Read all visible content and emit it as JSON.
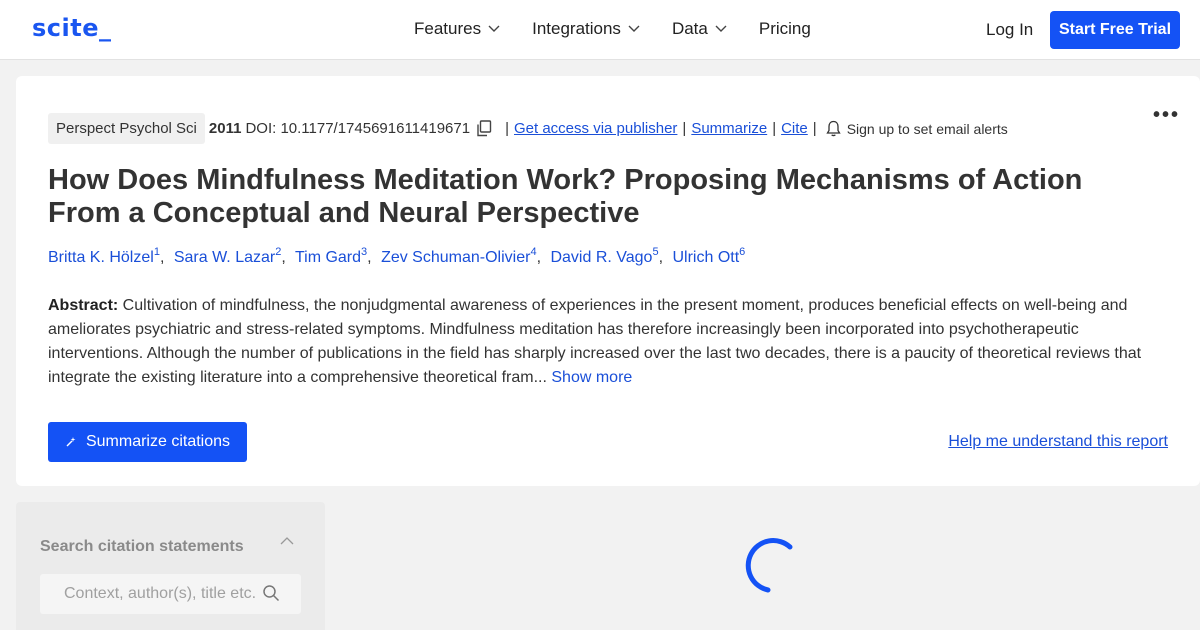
{
  "nav": {
    "logo": "scite_",
    "menu": [
      {
        "label": "Features",
        "has_dropdown": true
      },
      {
        "label": "Integrations",
        "has_dropdown": true
      },
      {
        "label": "Data",
        "has_dropdown": true
      },
      {
        "label": "Pricing",
        "has_dropdown": false
      }
    ],
    "login": "Log In",
    "trial": "Start Free Trial"
  },
  "paper": {
    "journal": "Perspect Psychol Sci",
    "year": "2011",
    "doi": "DOI: 10.1177/1745691611419671",
    "links": {
      "access": "Get access via publisher",
      "summarize": "Summarize",
      "cite": "Cite"
    },
    "separator": "|",
    "alerts": "Sign up to set email alerts",
    "more": "•••",
    "title": "How Does Mindfulness Meditation Work? Proposing Mechanisms of Action From a Conceptual and Neural Perspective",
    "authors": [
      {
        "name": "Britta K. Hölzel",
        "sup": "1"
      },
      {
        "name": "Sara W. Lazar",
        "sup": "2"
      },
      {
        "name": "Tim Gard",
        "sup": "3"
      },
      {
        "name": "Zev Schuman-Olivier",
        "sup": "4"
      },
      {
        "name": "David R. Vago",
        "sup": "5"
      },
      {
        "name": "Ulrich Ott",
        "sup": "6"
      }
    ],
    "abstract_label": "Abstract:",
    "abstract_text": " Cultivation of mindfulness, the nonjudgmental awareness of experiences in the present moment, produces beneficial effects on well-being and ameliorates psychiatric and stress-related symptoms. Mindfulness meditation has therefore increasingly been incorporated into psychotherapeutic interventions. Although the number of publications in the field has sharply increased over the last two decades, there is a paucity of theoretical reviews that integrate the existing literature into a comprehensive theoretical fram...",
    "show_more": "Show more",
    "summarize_btn": "Summarize citations",
    "help": "Help me understand this report"
  },
  "sidebar": {
    "title": "Search citation statements",
    "search_placeholder": "Context, author(s), title etc."
  },
  "colors": {
    "accent": "#1452f5",
    "link": "#1a4fd8"
  }
}
